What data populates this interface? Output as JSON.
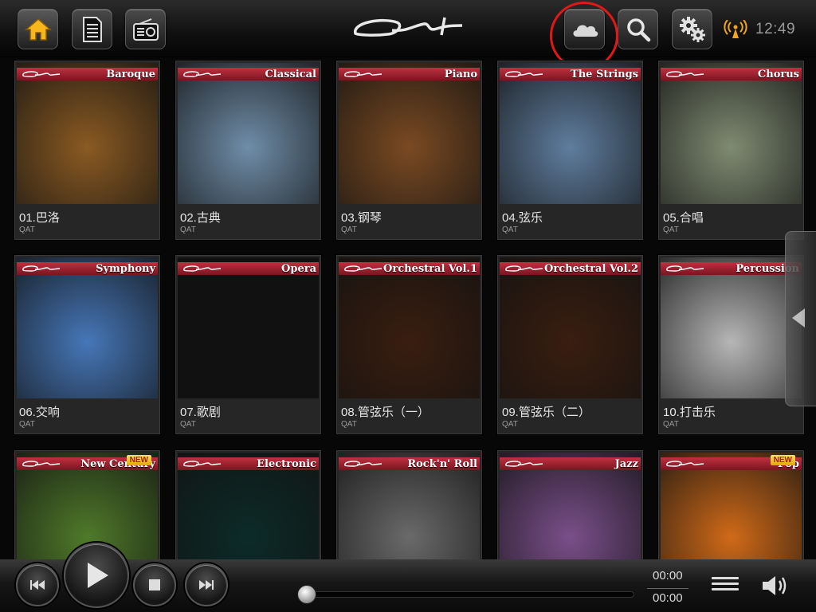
{
  "topbar": {
    "icons": [
      "home-icon",
      "document-list-icon",
      "radio-icon",
      "cloud-icon",
      "search-icon",
      "gear-icon",
      "wifi-signal-icon"
    ],
    "clock": "12:49",
    "logo": "ONT"
  },
  "albums": [
    {
      "banner": "Baroque",
      "name": "01.巴洛",
      "sub": "QAT",
      "bg": "#8a5a22",
      "new": false
    },
    {
      "banner": "Classical",
      "name": "02.古典",
      "sub": "QAT",
      "bg": "#6f8da8",
      "new": false
    },
    {
      "banner": "Piano",
      "name": "03.钢琴",
      "sub": "QAT",
      "bg": "#7a4a22",
      "new": false
    },
    {
      "banner": "The Strings",
      "name": "04.弦乐",
      "sub": "QAT",
      "bg": "#5f7d9e",
      "new": false
    },
    {
      "banner": "Chorus",
      "name": "05.合唱",
      "sub": "QAT",
      "bg": "#7f8b72",
      "new": false
    },
    {
      "banner": "Symphony",
      "name": "06.交响",
      "sub": "QAT",
      "bg": "#4677b8",
      "new": false
    },
    {
      "banner": "Opera",
      "name": "07.歌剧",
      "sub": "QAT",
      "bg": "#111111",
      "new": false
    },
    {
      "banner": "Orchestral Vol.1",
      "name": "08.管弦乐（一）",
      "sub": "QAT",
      "bg": "#3a1e10",
      "new": false
    },
    {
      "banner": "Orchestral Vol.2",
      "name": "09.管弦乐（二）",
      "sub": "QAT",
      "bg": "#3a1e10",
      "new": false
    },
    {
      "banner": "Percussion",
      "name": "10.打击乐",
      "sub": "QAT",
      "bg": "#b6b6b6",
      "new": false
    },
    {
      "banner": "New Century",
      "name": "",
      "sub": "",
      "bg": "#4f7a2a",
      "new": true
    },
    {
      "banner": "Electronic",
      "name": "",
      "sub": "",
      "bg": "#0c2b28",
      "new": false
    },
    {
      "banner": "Rock'n' Roll",
      "name": "",
      "sub": "",
      "bg": "#6a6a6a",
      "new": false
    },
    {
      "banner": "Jazz",
      "name": "",
      "sub": "",
      "bg": "#7a4f8a",
      "new": false
    },
    {
      "banner": "Pop",
      "name": "",
      "sub": "",
      "bg": "#d06a18",
      "new": true
    }
  ],
  "new_label": "NEW",
  "player": {
    "time_elapsed": "00:00",
    "time_total": "00:00",
    "progress": 0
  },
  "colors": {
    "banner_red": "#b02030",
    "highlight_circle": "#e01818",
    "home_icon": "#f2b21a"
  }
}
